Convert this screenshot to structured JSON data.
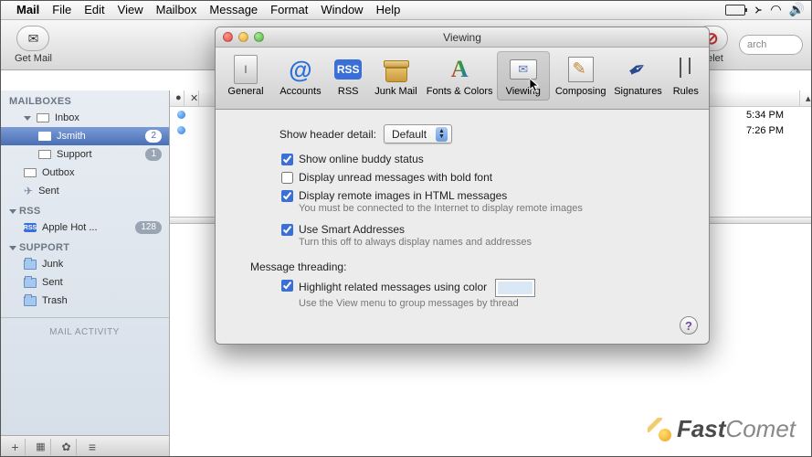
{
  "menubar": {
    "app": "Mail",
    "items": [
      "File",
      "Edit",
      "View",
      "Mailbox",
      "Message",
      "Format",
      "Window",
      "Help"
    ]
  },
  "mail_toolbar": {
    "get_mail": "Get Mail",
    "delete": "Delet",
    "search_placeholder": "arch"
  },
  "sidebar": {
    "mailboxes_heading": "MAILBOXES",
    "inbox": "Inbox",
    "inbox_children": [
      {
        "name": "Jsmith",
        "badge": "2",
        "selected": true
      },
      {
        "name": "Support",
        "badge": "1",
        "selected": false
      }
    ],
    "outbox": "Outbox",
    "sent": "Sent",
    "rss_heading": "RSS",
    "rss_items": [
      {
        "name": "Apple Hot ...",
        "badge": "128"
      }
    ],
    "support_heading": "SUPPORT",
    "support_items": [
      "Junk",
      "Sent",
      "Trash"
    ],
    "activity": "MAIL ACTIVITY"
  },
  "messages": {
    "times": [
      "5:34 PM",
      "7:26 PM"
    ]
  },
  "prefs": {
    "title": "Viewing",
    "tabs": [
      "General",
      "Accounts",
      "RSS",
      "Junk Mail",
      "Fonts & Colors",
      "Viewing",
      "Composing",
      "Signatures",
      "Rules"
    ],
    "selected_tab": "Viewing",
    "header_detail_label": "Show header detail:",
    "header_detail_value": "Default",
    "opt_buddy": "Show online buddy status",
    "opt_bold": "Display unread messages with bold font",
    "opt_remote": "Display remote images in HTML messages",
    "opt_remote_sub": "You must be connected to the Internet to display remote images",
    "opt_smart": "Use Smart Addresses",
    "opt_smart_sub": "Turn this off to always display names and addresses",
    "threading_label": "Message threading:",
    "opt_highlight": "Highlight related messages using color",
    "opt_highlight_sub": "Use the View menu to group messages by thread",
    "checks": {
      "buddy": true,
      "bold": false,
      "remote": true,
      "smart": true,
      "highlight": true
    }
  },
  "watermark": {
    "bold": "Fast",
    "light": "Comet"
  }
}
